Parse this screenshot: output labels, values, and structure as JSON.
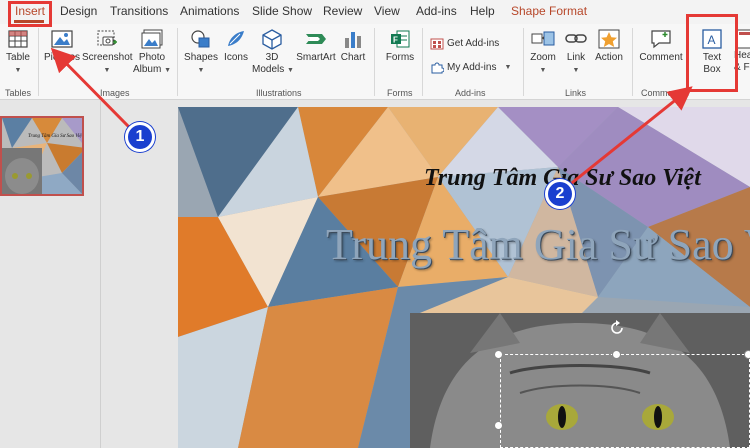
{
  "tabs": [
    {
      "key": "insert",
      "label": "Insert"
    },
    {
      "key": "design",
      "label": "Design"
    },
    {
      "key": "transitions",
      "label": "Transitions"
    },
    {
      "key": "animations",
      "label": "Animations"
    },
    {
      "key": "slideshow",
      "label": "Slide Show"
    },
    {
      "key": "review",
      "label": "Review"
    },
    {
      "key": "view",
      "label": "View"
    },
    {
      "key": "addins",
      "label": "Add-ins"
    },
    {
      "key": "help",
      "label": "Help"
    },
    {
      "key": "shapeformat",
      "label": "Shape Format"
    }
  ],
  "ribbon": {
    "table": "Table",
    "pictures": "Pictures",
    "screenshot": "Screenshot",
    "photo_album_1": "Photo",
    "photo_album_2": "Album",
    "shapes": "Shapes",
    "icons": "Icons",
    "models_1": "3D",
    "models_2": "Models",
    "smartart": "SmartArt",
    "chart": "Chart",
    "forms": "Forms",
    "get_addins": "Get Add-ins",
    "my_addins": "My Add-ins",
    "zoom": "Zoom",
    "link": "Link",
    "action": "Action",
    "comment": "Comment",
    "textbox_1": "Text",
    "textbox_2": "Box",
    "header_1": "Hea",
    "header_2": "& Fo"
  },
  "groups": {
    "tables": "Tables",
    "images": "Images",
    "illustrations": "Illustrations",
    "forms": "Forms",
    "addins": "Add-ins",
    "links": "Links",
    "comments": "Comments"
  },
  "slide": {
    "subtitle": "Trung Tâm Gia Sư Sao Việt",
    "title": "Trung Tâm Gia Sư Sao Việt",
    "thumb_title": "Trung Tâm Gia Sư Sao Việt"
  },
  "annotations": {
    "step1": "1",
    "step2": "2"
  },
  "colors": {
    "accent": "#b7472a",
    "highlight": "#e53935",
    "badge": "#1a3fcf"
  }
}
